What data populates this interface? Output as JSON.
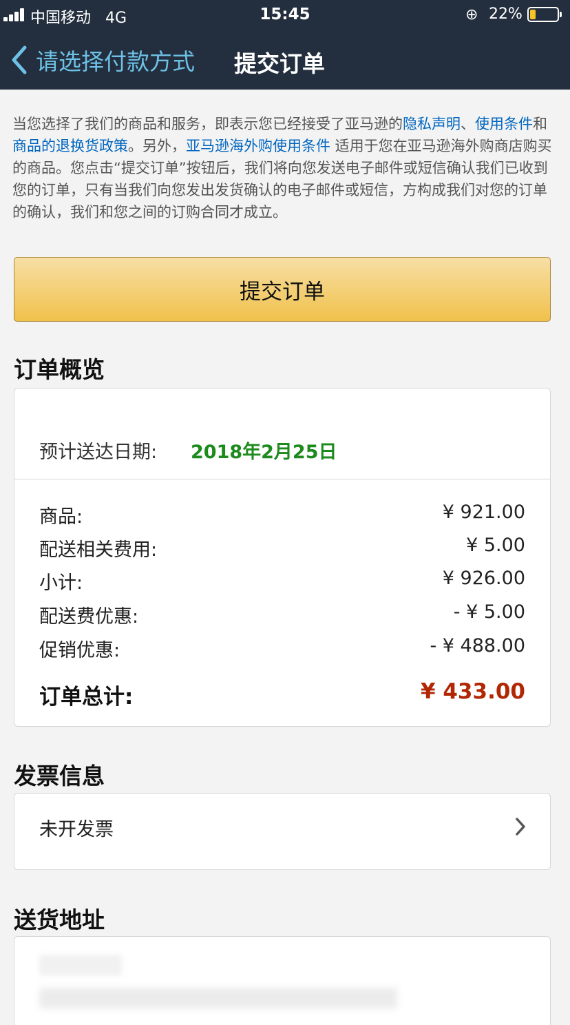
{
  "status_bar": {
    "carrier": "中国移动",
    "network": "4G",
    "time": "15:45",
    "battery": "22%",
    "battery_level": 0.22,
    "battery_color": "#f7c325"
  },
  "nav": {
    "back_label": "请选择付款方式",
    "title": "提交订单",
    "back_icon": "chevron-left-icon"
  },
  "legal": {
    "p1": "当您选择了我们的商品和服务，即表示您已经接受了亚马逊的",
    "link_privacy": "隐私声明",
    "sep1": "、",
    "link_terms": "使用条件",
    "p2": "和",
    "link_return": "商品的退换货政策",
    "p3": "。另外，",
    "link_overseas": "亚马逊海外购使用条件",
    "p4": " 适用于您在亚马逊海外购商店购买的商品。您点击“提交订单”按钮后，我们将向您发送电子邮件或短信确认我们已收到您的订单，只有当我们向您发出发货确认的电子邮件或短信，方构成我们对您的订单的确认，我们和您之间的订购合同才成立。"
  },
  "submit_button": "提交订单",
  "overview": {
    "title": "订单概览",
    "eta_label": "预计送达日期:",
    "eta_date": "2018年2月25日",
    "rows": [
      {
        "label": "商品:",
        "value": "¥ 921.00"
      },
      {
        "label": "配送相关费用:",
        "value": "¥ 5.00"
      },
      {
        "label": "小计:",
        "value": "¥ 926.00"
      },
      {
        "label": "配送费优惠:",
        "value": "- ¥ 5.00"
      },
      {
        "label": "促销优惠:",
        "value": "- ¥ 488.00"
      }
    ],
    "total_label": "订单总计:",
    "total_value": "¥ 433.00",
    "total_color": "#b12704"
  },
  "invoice": {
    "title": "发票信息",
    "value": "未开发票",
    "icon": "chevron-right-icon"
  },
  "address": {
    "title": "送货地址"
  },
  "colors": {
    "header_bg": "#232f3e",
    "link": "#0066c0",
    "eta": "#1d8a1d",
    "button": "#f0c14b"
  }
}
